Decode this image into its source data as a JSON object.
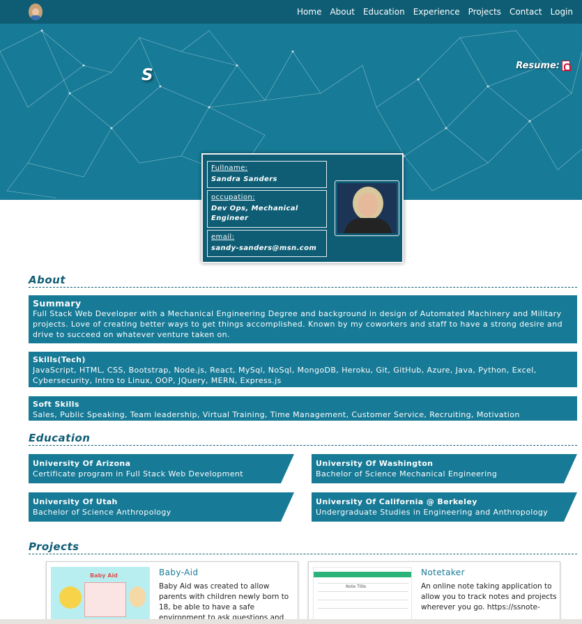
{
  "nav": {
    "links": [
      "Home",
      "About",
      "Education",
      "Experience",
      "Projects",
      "Contact",
      "Login"
    ]
  },
  "hero": {
    "initial": "S",
    "resume_label": "Resume:"
  },
  "profile": {
    "fullname_label": "Fullname:",
    "fullname": "Sandra Sanders",
    "occupation_label": "occupation:",
    "occupation": "Dev Ops, Mechanical Engineer",
    "email_label": "email:",
    "email": "sandy-sanders@msn.com"
  },
  "about": {
    "title": "About",
    "summary_head": "Summary",
    "summary_text": "Full Stack Web Developer with a Mechanical Engineering Degree and background in design of Automated Machinery and Military projects. Love of creating better ways to get things accomplished. Known by my coworkers and staff to have a strong desire and drive to succeed on whatever venture taken on.",
    "skills_head": "Skills(Tech)",
    "skills_text": "JavaScript, HTML, CSS, Bootstrap, Node.js, React, MySql, NoSql, MongoDB, Heroku, Git, GitHub, Azure, Java, Python, Excel, Cybersecurity, Intro to Linux, OOP, JQuery, MERN, Express.js",
    "soft_head": "Soft Skills",
    "soft_text": "Sales, Public Speaking, Team leadership, Virtual Training, Time Management, Customer Service, Recruiting, Motivation"
  },
  "education": {
    "title": "Education",
    "items": [
      {
        "school": "University Of Arizona",
        "program": "Certificate program in Full Stack Web Development"
      },
      {
        "school": "University Of Washington",
        "program": "Bachelor of Science Mechanical Engineering"
      },
      {
        "school": "University Of Utah",
        "program": "Bachelor of Science Anthropology"
      },
      {
        "school": "University Of California @ Berkeley",
        "program": "Undergraduate Studies in Engineering and Anthropology"
      }
    ]
  },
  "projects": {
    "title": "Projects",
    "items": [
      {
        "name": "Baby-Aid",
        "description": "Baby Aid was created to allow parents with children newly born to 18, be able to have a safe environment to ask questions and receive answers from",
        "thumb_title": "Baby Aid"
      },
      {
        "name": "Notetaker",
        "description": "An online note taking application to allow you to track notes and projects wherever you go. https://ssnote-",
        "thumb_text": "Note Title"
      }
    ]
  },
  "colors": {
    "nav_bg": "#0e5d75",
    "hero_bg": "#177a96",
    "accent": "#177a96"
  }
}
